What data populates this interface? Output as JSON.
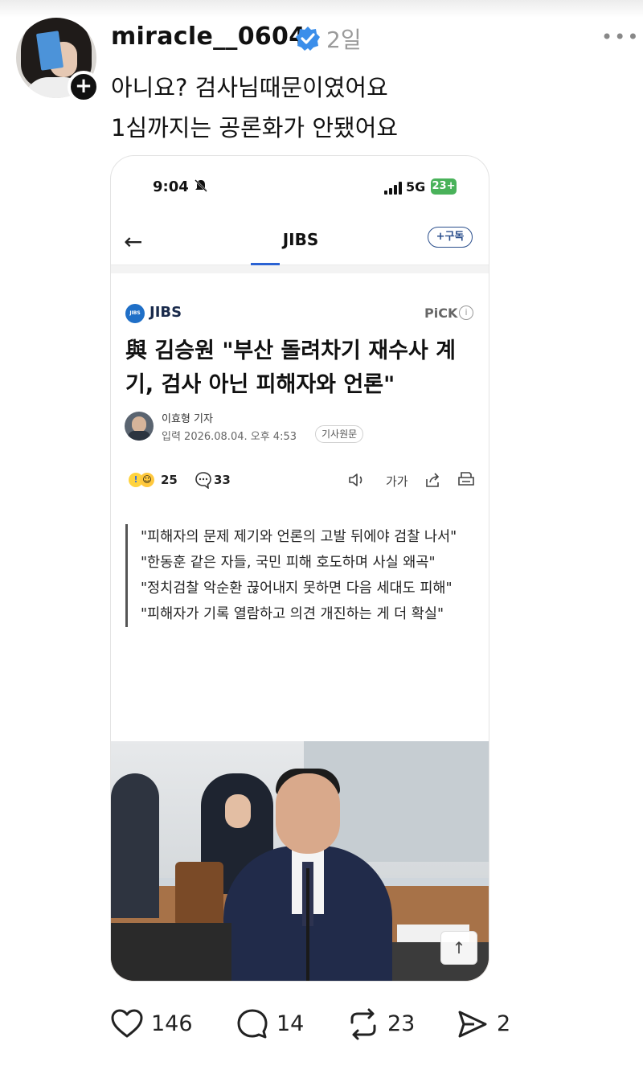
{
  "post": {
    "username": "miracle__0604",
    "time": "2일",
    "more": "•••",
    "plus": "+",
    "lines": [
      "아니요? 검사님때문이였어요",
      "1심까지는 공론화가 안됐어요"
    ]
  },
  "screenshot": {
    "status_bar": {
      "time": "9:04",
      "network": "5G",
      "battery": "23+"
    },
    "nav": {
      "back": "←",
      "title": "JIBS",
      "subscribe": "+구독"
    },
    "publisher": {
      "logo_text": "JIBS",
      "name": "JIBS",
      "pick": "PiCK",
      "info": "i"
    },
    "headline": "與 김승원 \"부산 돌려차기 재수사 계기, 검사 아닌 피해자와 언론\"",
    "reporter": {
      "name": "이효형 기자",
      "date": "입력 2026.08.04. 오후 4:53",
      "original": "기사원문"
    },
    "stats": {
      "reactions": "25",
      "comments": "33",
      "font_size": "가가"
    },
    "quotes": [
      "\"피해자의 문제 제기와 언론의 고발 뒤에야 검찰 나서\"",
      "\"한동훈 같은 자들, 국민 피해 호도하며 사실 왜곡\"",
      "\"정치검찰 악순환 끊어내지 못하면 다음 세대도 피해\"",
      "\"피해자가 기록 열람하고 의견 개진하는 게 더 확실\""
    ],
    "scroll_top": "↑"
  },
  "actions": {
    "likes": "146",
    "replies": "14",
    "reposts": "23",
    "shares": "2"
  },
  "colors": {
    "verified": "#3b8eea",
    "accent": "#2a62d3",
    "subscribe": "#2a4e8c"
  },
  "icons": [
    "heart-icon",
    "comment-icon",
    "repost-icon",
    "share-icon",
    "verified-badge-icon"
  ]
}
